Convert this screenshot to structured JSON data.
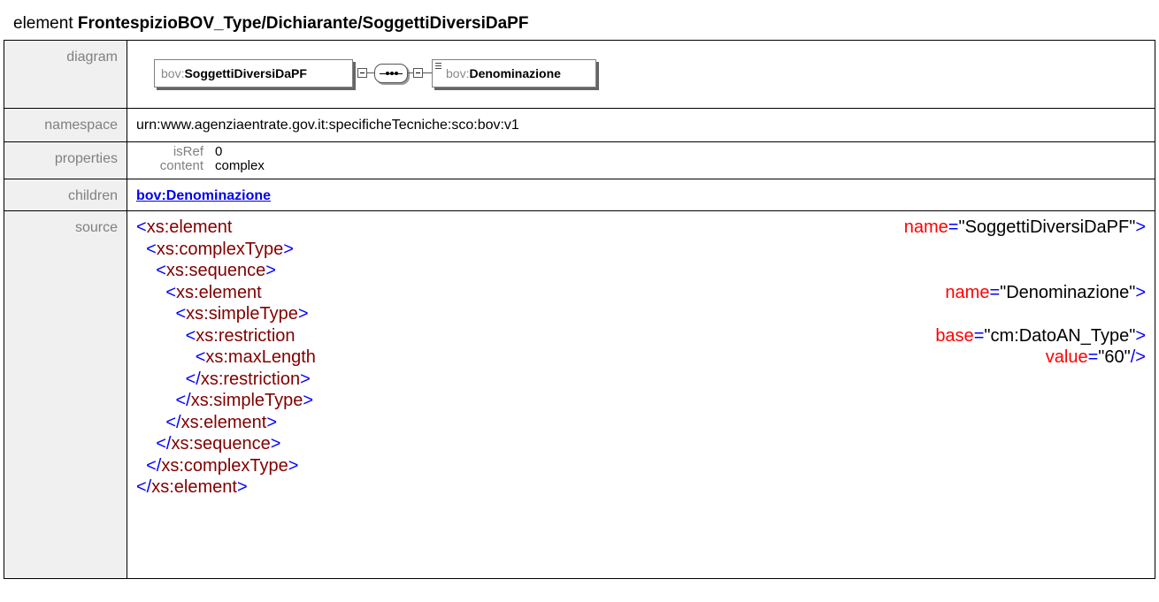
{
  "page_title": {
    "prefix": "element ",
    "name": "FrontespizioBOV_Type/Dichiarante/SoggettiDiversiDaPF"
  },
  "labels": {
    "diagram": "diagram",
    "namespace": "namespace",
    "properties": "properties",
    "children": "children",
    "source": "source"
  },
  "diagram": {
    "element_prefix": "bov:",
    "element_name": "SoggettiDiversiDaPF",
    "child_prefix": "bov:",
    "child_name": "Denominazione"
  },
  "namespace": "urn:www.agenziaentrate.gov.it:specificheTecniche:sco:bov:v1",
  "properties": [
    {
      "key": "isRef",
      "value": "0"
    },
    {
      "key": "content",
      "value": "complex"
    }
  ],
  "children": [
    "bov:Denominazione"
  ],
  "source": {
    "l1_tag": "xs:element",
    "l1_attr": "name",
    "l1_val": "\"SoggettiDiversiDaPF\"",
    "l2_tag": "xs:complexType",
    "l3_tag": "xs:sequence",
    "l4_tag": "xs:element",
    "l4_attr": "name",
    "l4_val": "\"Denominazione\"",
    "l5_tag": "xs:simpleType",
    "l6_tag": "xs:restriction",
    "l6_attr": "base",
    "l6_val": "\"cm:DatoAN_Type\"",
    "l7_tag": "xs:maxLength",
    "l7_attr": "value",
    "l7_val": "\"60\"",
    "l8_tag": "xs:restriction",
    "l9_tag": "xs:simpleType",
    "l10_tag": "xs:element",
    "l11_tag": "xs:sequence",
    "l12_tag": "xs:complexType",
    "l13_tag": "xs:element"
  },
  "colors": {
    "markup": "#0000ff",
    "element_name": "#800000",
    "attribute": "#ff0000",
    "label_background": "#f0f0f0"
  }
}
